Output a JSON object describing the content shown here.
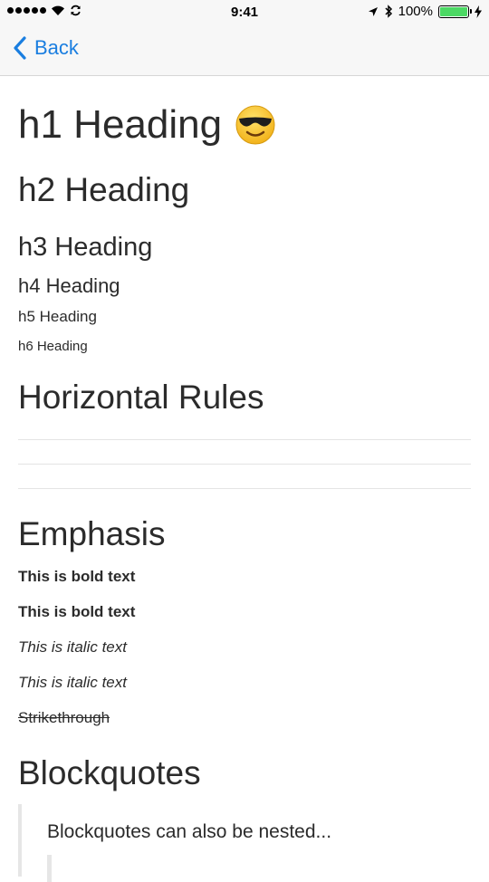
{
  "status_bar": {
    "time": "9:41",
    "battery": "100%",
    "battery_level": 1.0,
    "signal_icon": "signal-dots-icon",
    "wifi_icon": "wifi-icon",
    "sync_icon": "sync-icon",
    "location_icon": "location-arrow-icon",
    "bluetooth_icon": "bluetooth-icon",
    "charging_icon": "charging-bolt-icon",
    "battery_color": "#4cd964"
  },
  "nav": {
    "back_label": "Back",
    "accent_color": "#1a7ee0"
  },
  "content": {
    "h1": "h1 Heading",
    "h1_emoji": "smiling-face-with-sunglasses",
    "h2": "h2 Heading",
    "h3": "h3 Heading",
    "h4": "h4 Heading",
    "h5": "h5 Heading",
    "h6": "h6 Heading",
    "horizontal_rules_title": "Horizontal Rules",
    "emphasis_title": "Emphasis",
    "bold_1": "This is bold text",
    "bold_2": "This is bold text",
    "italic_1": "This is italic text",
    "italic_2": "This is italic text",
    "strikethrough": "Strikethrough",
    "blockquotes_title": "Blockquotes",
    "blockquote_text": "Blockquotes can also be nested..."
  }
}
